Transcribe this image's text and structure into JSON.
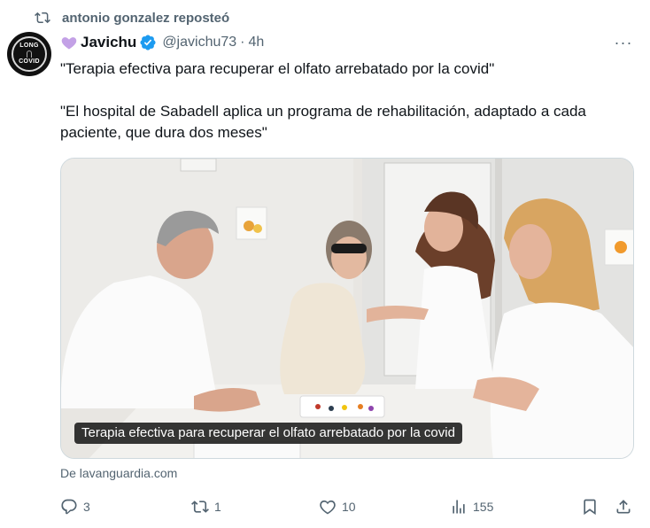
{
  "repost": {
    "text": "antonio gonzalez reposteó"
  },
  "author": {
    "avatar_text_line1": "LONG",
    "avatar_text_line2": "COVID",
    "name": "Javichu",
    "handle": "@javichu73",
    "separator": "·",
    "time": "4h"
  },
  "more_label": "···",
  "tweet": {
    "line1": "\"Terapia efectiva para recuperar el olfato arrebatado por la covid\"",
    "line2": "\"El hospital de Sabadell aplica un programa de rehabilitación, adaptado a cada paciente, que dura dos meses\""
  },
  "media": {
    "caption": "Terapia efectiva para recuperar el olfato arrebatado por la covid"
  },
  "source": "De lavanguardia.com",
  "actions": {
    "replies": "3",
    "reposts": "1",
    "likes": "10",
    "views": "155"
  },
  "colors": {
    "muted": "#536471",
    "text": "#0f1419",
    "verified": "#1d9bf0",
    "heart": "#c3a1e6"
  }
}
